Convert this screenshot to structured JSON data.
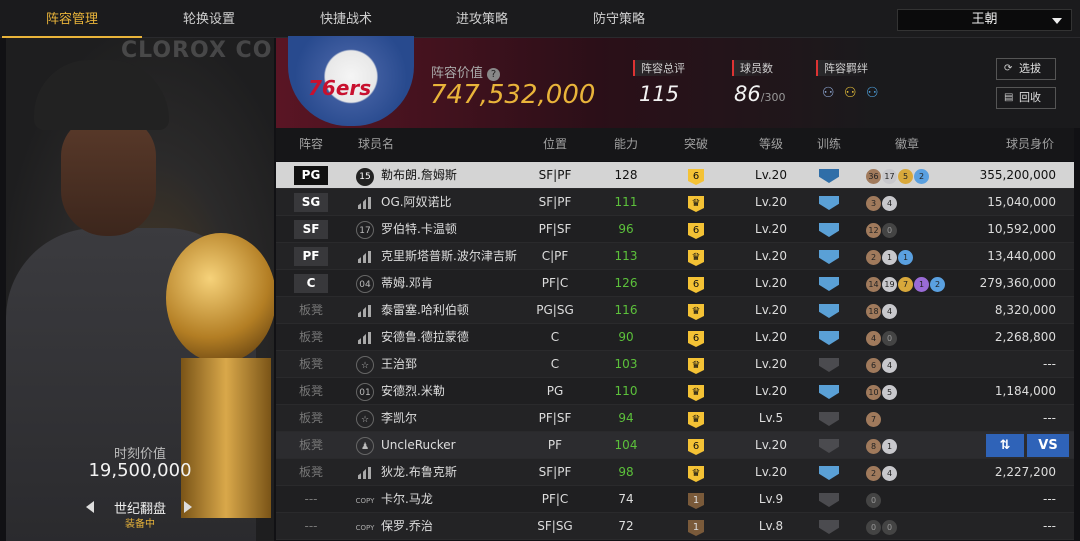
{
  "nav": {
    "tabs": [
      "阵容管理",
      "轮换设置",
      "快捷战术",
      "进攻策略",
      "防守策略"
    ],
    "active": 0,
    "team_select": "王朝"
  },
  "card": {
    "watermark": "CLOROX CO",
    "caption": "时刻价值",
    "value": "19,500,000",
    "skill": "世纪翻盘",
    "status": "装备中"
  },
  "header": {
    "team_logo": "76ers",
    "value_label": "阵容价值",
    "value": "747,532,000",
    "stats": [
      {
        "label": "阵容总评",
        "value": "115",
        "sub": ""
      },
      {
        "label": "球员数",
        "value": "86",
        "sub": "/300"
      },
      {
        "label": "阵容羁绊",
        "value": "",
        "sub": ""
      }
    ],
    "buttons": [
      {
        "label": "选拔",
        "icon": "refresh-icon"
      },
      {
        "label": "回收",
        "icon": "doc-icon"
      }
    ]
  },
  "table": {
    "headers": [
      "阵容",
      "球员名",
      "位置",
      "能力",
      "突破",
      "等级",
      "训练",
      "徽章",
      "球员身价"
    ],
    "rows": [
      {
        "slot": "PG",
        "badge": "15",
        "name": "勒布朗.詹姆斯",
        "pos": "SF|PF",
        "ovr": "128",
        "brk": "6",
        "brk_type": "gold",
        "lvl": "Lv.20",
        "train": "blue",
        "badges": [
          [
            "b",
            "36"
          ],
          [
            "s",
            "17"
          ],
          [
            "g",
            "5"
          ],
          [
            "d",
            "2"
          ]
        ],
        "price": "355,200,000",
        "selected": true
      },
      {
        "slot": "SG",
        "badge": "",
        "name": "OG.阿奴诺比",
        "pos": "SF|PF",
        "ovr": "111",
        "brk": "♛",
        "brk_type": "gold",
        "lvl": "Lv.20",
        "train": "blue",
        "badges": [
          [
            "b",
            "3"
          ],
          [
            "s",
            "4"
          ]
        ],
        "price": "15,040,000"
      },
      {
        "slot": "SF",
        "badge": "17",
        "name": "罗伯特.卡温顿",
        "pos": "PF|SF",
        "ovr": "96",
        "brk": "6",
        "brk_type": "gold",
        "lvl": "Lv.20",
        "train": "blue",
        "badges": [
          [
            "b",
            "12"
          ],
          [
            "x",
            "0"
          ]
        ],
        "price": "10,592,000"
      },
      {
        "slot": "PF",
        "badge": "",
        "name": "克里斯塔普斯.波尔津吉斯",
        "pos": "C|PF",
        "ovr": "113",
        "brk": "♛",
        "brk_type": "gold",
        "lvl": "Lv.20",
        "train": "blue",
        "badges": [
          [
            "b",
            "2"
          ],
          [
            "s",
            "1"
          ],
          [
            "d",
            "1"
          ]
        ],
        "price": "13,440,000"
      },
      {
        "slot": "C",
        "badge": "04",
        "name": "蒂姆.邓肯",
        "pos": "PF|C",
        "ovr": "126",
        "brk": "6",
        "brk_type": "gold",
        "lvl": "Lv.20",
        "train": "blue",
        "badges": [
          [
            "b",
            "14"
          ],
          [
            "s",
            "19"
          ],
          [
            "g",
            "7"
          ],
          [
            "p",
            "1"
          ],
          [
            "d",
            "2"
          ]
        ],
        "price": "279,360,000"
      },
      {
        "slot": "板凳",
        "badge": "",
        "name": "泰雷塞.哈利伯顿",
        "pos": "PG|SG",
        "ovr": "116",
        "brk": "♛",
        "brk_type": "gold",
        "lvl": "Lv.20",
        "train": "blue",
        "badges": [
          [
            "b",
            "18"
          ],
          [
            "s",
            "4"
          ]
        ],
        "price": "8,320,000"
      },
      {
        "slot": "板凳",
        "badge": "",
        "name": "安德鲁.德拉蒙德",
        "pos": "C",
        "ovr": "90",
        "brk": "6",
        "brk_type": "gold",
        "lvl": "Lv.20",
        "train": "blue",
        "badges": [
          [
            "b",
            "4"
          ],
          [
            "x",
            "0"
          ]
        ],
        "price": "2,268,800"
      },
      {
        "slot": "板凳",
        "badge": "☆",
        "name": "王治郅",
        "pos": "C",
        "ovr": "103",
        "brk": "♛",
        "brk_type": "gold",
        "lvl": "Lv.20",
        "train": "grey",
        "badges": [
          [
            "b",
            "6"
          ],
          [
            "s",
            "4"
          ]
        ],
        "price": "---"
      },
      {
        "slot": "板凳",
        "badge": "01",
        "name": "安德烈.米勒",
        "pos": "PG",
        "ovr": "110",
        "brk": "♛",
        "brk_type": "gold",
        "lvl": "Lv.20",
        "train": "blue",
        "badges": [
          [
            "b",
            "10"
          ],
          [
            "s",
            "5"
          ]
        ],
        "price": "1,184,000"
      },
      {
        "slot": "板凳",
        "badge": "☆",
        "name": "李凯尔",
        "pos": "PF|SF",
        "ovr": "94",
        "brk": "♛",
        "brk_type": "gold",
        "lvl": "Lv.5",
        "train": "grey",
        "badges": [
          [
            "b",
            "7"
          ]
        ],
        "price": "---"
      },
      {
        "slot": "板凳",
        "badge": "♟",
        "name": "UncleRucker",
        "pos": "PF",
        "ovr": "104",
        "brk": "6",
        "brk_type": "gold",
        "lvl": "Lv.20",
        "train": "grey",
        "badges": [
          [
            "b",
            "8"
          ],
          [
            "s",
            "1"
          ]
        ],
        "price": "",
        "vs": "VS",
        "highlight": true
      },
      {
        "slot": "板凳",
        "badge": "",
        "name": "狄龙.布鲁克斯",
        "pos": "SF|PF",
        "ovr": "98",
        "brk": "♛",
        "brk_type": "gold",
        "lvl": "Lv.20",
        "train": "blue",
        "badges": [
          [
            "b",
            "2"
          ],
          [
            "s",
            "4"
          ]
        ],
        "price": "2,227,200"
      },
      {
        "slot": "---",
        "badge": "COPY",
        "name": "卡尔.马龙",
        "pos": "PF|C",
        "ovr": "74",
        "brk": "1",
        "brk_type": "brn",
        "lvl": "Lv.9",
        "train": "grey",
        "badges": [
          [
            "x",
            "0"
          ]
        ],
        "price": "---"
      },
      {
        "slot": "---",
        "badge": "COPY",
        "name": "保罗.乔治",
        "pos": "SF|SG",
        "ovr": "72",
        "brk": "1",
        "brk_type": "brn",
        "lvl": "Lv.8",
        "train": "grey",
        "badges": [
          [
            "x",
            "0"
          ],
          [
            "x",
            "0"
          ]
        ],
        "price": "---"
      }
    ]
  }
}
